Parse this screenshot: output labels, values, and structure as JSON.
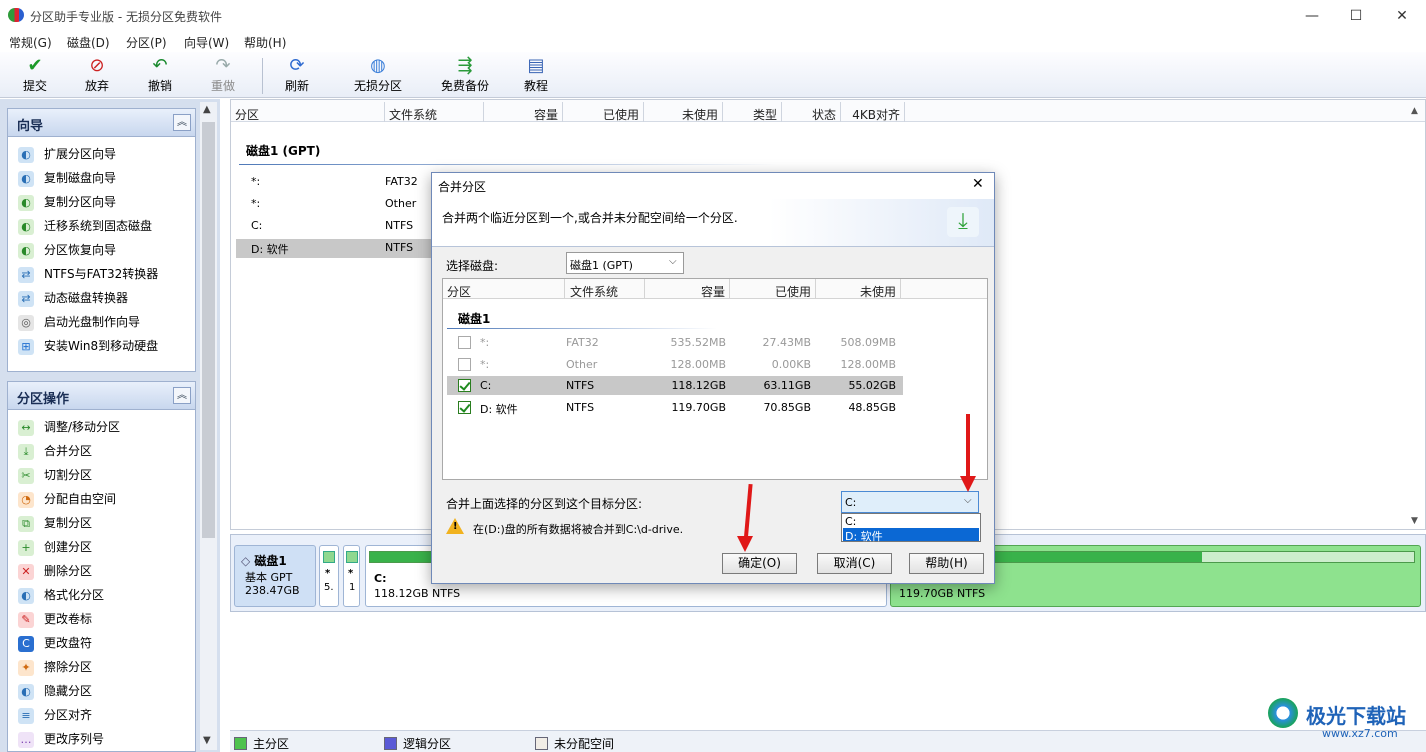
{
  "app": {
    "title": "分区助手专业版 - 无损分区免费软件"
  },
  "menu": [
    "常规(G)",
    "磁盘(D)",
    "分区(P)",
    "向导(W)",
    "帮助(H)"
  ],
  "toolbar": {
    "submit": "提交",
    "discard": "放弃",
    "undo": "撤销",
    "redo": "重做",
    "refresh": "刷新",
    "lossless": "无损分区",
    "backup": "免费备份",
    "tutorial": "教程"
  },
  "wizard": {
    "title": "向导",
    "items": [
      "扩展分区向导",
      "复制磁盘向导",
      "复制分区向导",
      "迁移系统到固态磁盘",
      "分区恢复向导",
      "NTFS与FAT32转换器",
      "动态磁盘转换器",
      "启动光盘制作向导",
      "安装Win8到移动硬盘"
    ]
  },
  "ops": {
    "title": "分区操作",
    "items": [
      "调整/移动分区",
      "合并分区",
      "切割分区",
      "分配自由空间",
      "复制分区",
      "创建分区",
      "删除分区",
      "格式化分区",
      "更改卷标",
      "更改盘符",
      "擦除分区",
      "隐藏分区",
      "分区对齐",
      "更改序列号"
    ]
  },
  "columns": [
    "分区",
    "文件系统",
    "容量",
    "已使用",
    "未使用",
    "类型",
    "状态",
    "4KB对齐"
  ],
  "disk": {
    "name": "磁盘1 (GPT)",
    "rows": [
      {
        "p": "*:",
        "fs": "FAT32"
      },
      {
        "p": "*:",
        "fs": "Other"
      },
      {
        "p": "C:",
        "fs": "NTFS"
      },
      {
        "p": "D: 软件",
        "fs": "NTFS"
      }
    ]
  },
  "diskbar": {
    "name": "磁盘1",
    "type": "基本 GPT",
    "size": "238.47GB",
    "p1a": "*",
    "p1b": "5.",
    "p2a": "*",
    "p2b": "1",
    "c_label": "C:",
    "c_size": "118.12GB NTFS",
    "d_size": "119.70GB NTFS"
  },
  "legend": {
    "primary": "主分区",
    "logical": "逻辑分区",
    "unalloc": "未分配空间"
  },
  "dialog": {
    "title": "合并分区",
    "desc": "合并两个临近分区到一个,或合并未分配空间给一个分区.",
    "select_label": "选择磁盘:",
    "select_value": "磁盘1 (GPT)",
    "cols": [
      "分区",
      "文件系统",
      "容量",
      "已使用",
      "未使用"
    ],
    "disk": "磁盘1",
    "rows": [
      {
        "p": "*:",
        "fs": "FAT32",
        "cap": "535.52MB",
        "used": "27.43MB",
        "free": "508.09MB",
        "checked": false
      },
      {
        "p": "*:",
        "fs": "Other",
        "cap": "128.00MB",
        "used": "0.00KB",
        "free": "128.00MB",
        "checked": false
      },
      {
        "p": "C:",
        "fs": "NTFS",
        "cap": "118.12GB",
        "used": "63.11GB",
        "free": "55.02GB",
        "checked": true
      },
      {
        "p": "D:  软件",
        "fs": "NTFS",
        "cap": "119.70GB",
        "used": "70.85GB",
        "free": "48.85GB",
        "checked": true
      }
    ],
    "merge_label": "合并上面选择的分区到这个目标分区:",
    "target_value": "C:",
    "options": [
      "C:",
      "D:  软件"
    ],
    "warning": "在(D:)盘的所有数据将被合并到C:\\d-drive.",
    "ok": "确定(O)",
    "cancel": "取消(C)",
    "help": "帮助(H)"
  },
  "watermark": {
    "name": "极光下载站",
    "url": "www.xz7.com"
  }
}
